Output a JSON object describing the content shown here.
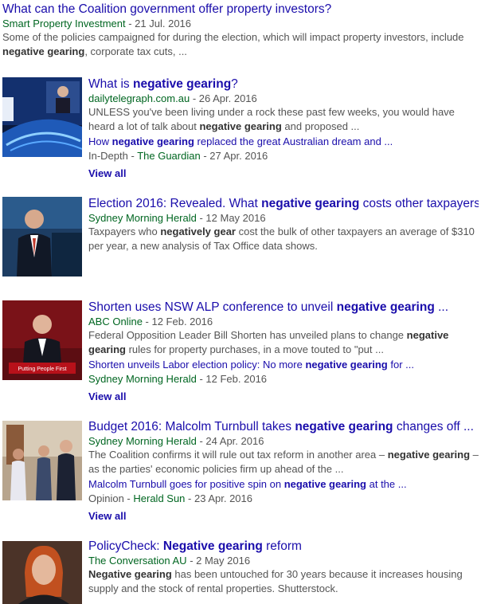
{
  "results": [
    {
      "title": [
        "What can the Coalition government offer property investors?"
      ],
      "source": "Smart Property Investment",
      "date": " - 21 Jul. 2016",
      "snippet": [
        "Some of the policies campaigned for during the election, which will impact property investors, include ",
        "negative gearing",
        ", corporate tax cuts, ..."
      ]
    },
    {
      "title": [
        "What is ",
        "negative gearing",
        "?"
      ],
      "source": "dailytelegraph.com.au",
      "date": " - 26 Apr. 2016",
      "snippet": [
        "UNLESS you've been living under a rock these past few weeks, you would have heard a lot of talk about ",
        "negative gearing",
        " and proposed ..."
      ],
      "sublink": [
        "How ",
        "negative gearing",
        " replaced the great Australian dream and ..."
      ],
      "sub_prefix": "In-Depth",
      "sub_source": "The Guardian",
      "sub_date": " - 27 Apr. 2016",
      "view_all": "View all"
    },
    {
      "title": [
        "Election 2016: Revealed. What ",
        "negative gearing",
        " costs other taxpayers"
      ],
      "source": "Sydney Morning Herald",
      "date": " - 12 May 2016",
      "snippet": [
        "Taxpayers who ",
        "negatively gear",
        " cost the bulk of other taxpayers an average of $310 per year, a new analysis of Tax Office data shows."
      ]
    },
    {
      "title": [
        "Shorten uses NSW ALP conference to unveil ",
        "negative gearing",
        " ..."
      ],
      "source": "ABC Online",
      "date": " - 12 Feb. 2016",
      "snippet": [
        "Federal Opposition Leader Bill Shorten has unveiled plans to change ",
        "negative gearing",
        " rules for property purchases, in a move touted to \"put ..."
      ],
      "sublink": [
        "Shorten unveils Labor election policy: No more ",
        "negative gearing",
        " for ..."
      ],
      "sub_source": "Sydney Morning Herald",
      "sub_date": " - 12 Feb. 2016",
      "view_all": "View all",
      "thumb_caption": "Putting People First"
    },
    {
      "title": [
        "Budget 2016: Malcolm Turnbull takes ",
        "negative gearing",
        " changes off ..."
      ],
      "source": "Sydney Morning Herald",
      "date": " - 24 Apr. 2016",
      "snippet": [
        "The Coalition confirms it will rule out tax reform in another area – ",
        "negative gearing",
        " – as the parties' economic policies firm up ahead of the ..."
      ],
      "sublink": [
        "Malcolm Turnbull goes for positive spin on ",
        "negative gearing",
        " at the ..."
      ],
      "sub_prefix": "Opinion",
      "sub_source": "Herald Sun",
      "sub_date": " - 23 Apr. 2016",
      "view_all": "View all"
    },
    {
      "title": [
        "PolicyCheck: ",
        "Negative gearing",
        " reform"
      ],
      "source": "The Conversation AU",
      "date": " - 2 May 2016",
      "snippet": [
        "",
        "Negative gearing",
        " has been untouched for 30 years because it increases housing supply and the stock of rental properties. Shutterstock."
      ]
    }
  ],
  "colors": {
    "link": "#1a0dab",
    "source": "#006621",
    "snippet": "#545454"
  }
}
